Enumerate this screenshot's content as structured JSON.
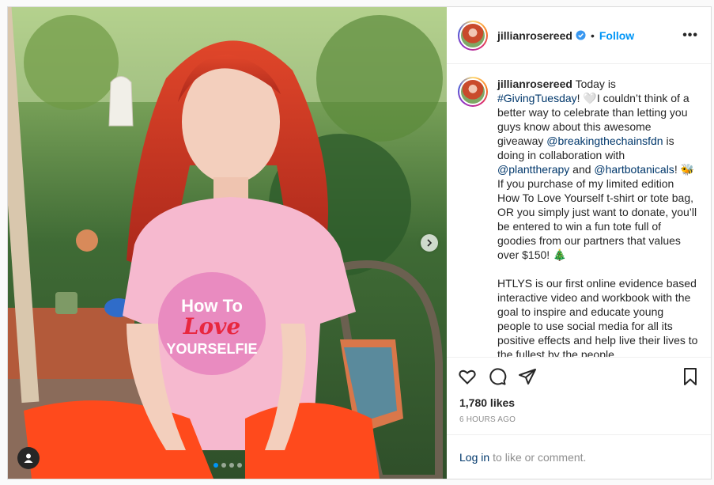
{
  "post": {
    "username": "jillianrosereed",
    "separator": "•",
    "follow_label": "Follow",
    "more_label": "•••",
    "caption_parts": [
      {
        "type": "user",
        "text": "jillianrosereed"
      },
      {
        "type": "text",
        "text": " Today is "
      },
      {
        "type": "link",
        "text": "#GivingTuesday"
      },
      {
        "type": "text",
        "text": "! 🤍I couldn’t think of a better way to celebrate than letting you guys know about this awesome giveaway "
      },
      {
        "type": "link",
        "text": "@breakingthechainsfdn"
      },
      {
        "type": "text",
        "text": " is doing in collaboration with "
      },
      {
        "type": "link",
        "text": "@planttherapy"
      },
      {
        "type": "text",
        "text": " and "
      },
      {
        "type": "link",
        "text": "@hartbotanicals"
      },
      {
        "type": "text",
        "text": "! 🐝If you purchase of my limited edition How To Love Yourself t-shirt or tote bag, OR you simply just want to donate, you’ll be entered to win a fun tote full of goodies from our partners that values over $150! 🎄\n\nHTLYS is our first online evidence based interactive video and workbook with the goal to inspire and educate young people to use social media for all its positive effects and help live their lives to the fullest by the people"
      }
    ],
    "likes": "1,780 likes",
    "time": "6 HOURS AGO",
    "login_link": "Log in",
    "login_rest": "to like or comment.",
    "carousel": {
      "count": 4,
      "active": 0
    }
  },
  "icons": {
    "verified": "verified-badge-icon",
    "like": "heart-icon",
    "comment": "comment-icon",
    "share": "paper-plane-icon",
    "save": "bookmark-icon",
    "tag": "user-tag-icon",
    "next": "chevron-right-icon"
  },
  "colors": {
    "accent": "#0095f6",
    "link": "#00376b",
    "muted": "#8e8e8e"
  }
}
